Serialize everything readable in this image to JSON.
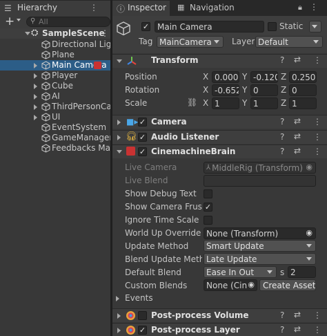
{
  "hierarchy": {
    "tab_label": "Hierarchy",
    "add_label": "+",
    "search_placeholder": "All",
    "scene_name": "SampleScene",
    "items": [
      {
        "label": "Directional Ligh",
        "selected": false
      },
      {
        "label": "Plane",
        "selected": false
      },
      {
        "label": "Main Camera",
        "selected": true,
        "has_children": true
      },
      {
        "label": "Player",
        "selected": false,
        "has_children": true
      },
      {
        "label": "Cube",
        "selected": false,
        "has_children": true
      },
      {
        "label": "AI",
        "selected": false,
        "has_children": true
      },
      {
        "label": "ThirdPersonCar",
        "selected": false,
        "has_children": true
      },
      {
        "label": "UI",
        "selected": false,
        "has_children": true
      },
      {
        "label": "EventSystem",
        "selected": false
      },
      {
        "label": "GameManager",
        "selected": false
      },
      {
        "label": "Feedbacks Mar",
        "selected": false
      }
    ]
  },
  "inspector": {
    "tab_label": "Inspector",
    "navigation_tab_label": "Navigation",
    "object_name": "Main Camera",
    "static_label": "Static",
    "tag_label": "Tag",
    "tag_value": "MainCamera",
    "layer_label": "Layer",
    "layer_value": "Default",
    "transform": {
      "title": "Transform",
      "position_label": "Position",
      "rotation_label": "Rotation",
      "scale_label": "Scale",
      "x": "X",
      "y": "Y",
      "z": "Z",
      "position": [
        "0.000",
        "-0.120",
        "0.250"
      ],
      "rotation": [
        "-0.652",
        "0",
        "0"
      ],
      "scale": [
        "1",
        "1",
        "1"
      ]
    },
    "components": {
      "camera": "Camera",
      "audio_listener": "Audio Listener",
      "cinemachine_brain": "CinemachineBrain",
      "post_process_volume": "Post-process Volume",
      "post_process_layer": "Post-process Layer"
    },
    "brain": {
      "live_camera_label": "Live Camera",
      "live_camera_value": "MiddleRig (Transform)",
      "live_blend_label": "Live Blend",
      "show_debug_text_label": "Show Debug Text",
      "show_camera_frustum_label": "Show Camera Frustu",
      "ignore_time_scale_label": "Ignore Time Scale",
      "world_up_override_label": "World Up Override",
      "world_up_override_value": "None (Transform)",
      "update_method_label": "Update Method",
      "update_method_value": "Smart Update",
      "blend_update_method_label": "Blend Update Metho",
      "blend_update_method_value": "Late Update",
      "default_blend_label": "Default Blend",
      "default_blend_value": "Ease In Out",
      "default_blend_s_label": "s",
      "default_blend_seconds": "2",
      "custom_blends_label": "Custom Blends",
      "custom_blends_value": "None (Cin",
      "create_asset_label": "Create Asset",
      "events_label": "Events"
    }
  },
  "colors": {
    "selection": "#2c5d87",
    "panel": "#383838",
    "header": "#3e3e3e",
    "tab_bar": "#282828"
  }
}
